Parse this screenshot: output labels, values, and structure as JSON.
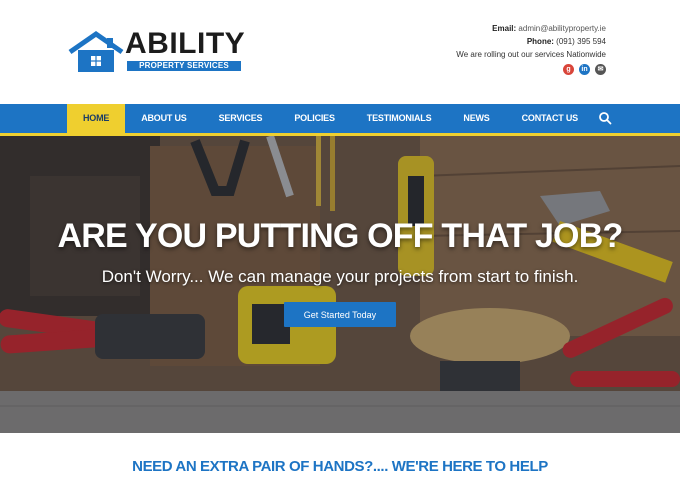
{
  "logo": {
    "brand": "ABILITY",
    "tagline": "PROPERTY SERVICES"
  },
  "contact": {
    "email_label": "Email:",
    "email_value": "admin@abilityproperty.ie",
    "phone_label": "Phone:",
    "phone_value": "(091) 395 594",
    "rollout": "We are rolling out our services Nationwide"
  },
  "social": {
    "google_icon": "google-plus-icon",
    "linkedin_icon": "linkedin-icon",
    "email_icon": "email-icon"
  },
  "nav": {
    "items": [
      {
        "label": "HOME",
        "active": true
      },
      {
        "label": "ABOUT US"
      },
      {
        "label": "SERVICES"
      },
      {
        "label": "POLICIES"
      },
      {
        "label": "TESTIMONIALS"
      },
      {
        "label": "NEWS"
      },
      {
        "label": "CONTACT US"
      }
    ],
    "search_icon": "search-icon"
  },
  "hero": {
    "headline": "ARE YOU PUTTING OFF THAT JOB?",
    "subheadline": "Don't Worry... We can manage your projects from start to finish.",
    "cta_label": "Get Started Today"
  },
  "bottom": {
    "tagline": "NEED AN EXTRA PAIR OF HANDS?.... WE'RE HERE TO HELP"
  },
  "colors": {
    "brand_blue": "#1d74c4",
    "accent_yellow": "#efcf2f",
    "text_dark": "#1c1c1c"
  }
}
